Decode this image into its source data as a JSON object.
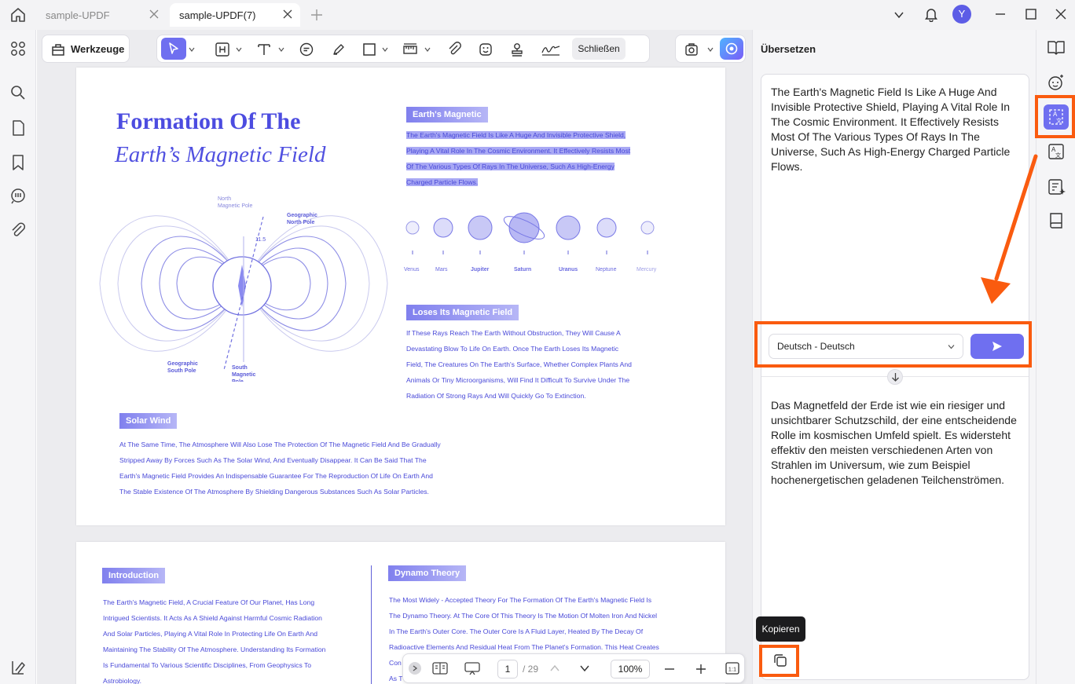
{
  "tabs": [
    {
      "label": "sample-UPDF",
      "active": false
    },
    {
      "label": "sample-UPDF(7)",
      "active": true
    }
  ],
  "window": {
    "avatar_letter": "Y"
  },
  "toolbar": {
    "tools_label": "Werkzeuge",
    "close_label": "Schließen"
  },
  "page1": {
    "title_line1": "Formation Of The",
    "title_line2": "Earth’s Magnetic Field",
    "diagram_labels": {
      "north_magnetic": "North\nMagnetic Pole",
      "geo_north": "Geographic\nNorth Pole",
      "angle": "11.5°",
      "geo_south": "Geographic\nSouth Pole",
      "south_magnetic": "South\nMagnetic\nPole"
    },
    "section1_title": "Earth's Magnetic",
    "section1_lines": [
      "The Earth's Magnetic Field Is Like A Huge And Invisible Protective Shield,",
      "Playing A Vital Role In The Cosmic Environment. It Effectively Resists Most",
      "Of The Various Types Of Rays In The Universe, Such As High-Energy",
      "Charged Particle Flows."
    ],
    "planets": [
      "Venus",
      "Mars",
      "Jupiter",
      "Saturn",
      "Uranus",
      "Neptune",
      "Mercury"
    ],
    "section2_title": "Loses Its Magnetic Field",
    "section2_lines": [
      "If These Rays Reach The Earth Without Obstruction, They Will Cause A",
      "Devastating Blow To Life On Earth. Once The Earth Loses Its Magnetic",
      "Field, The Creatures On The Earth's Surface, Whether Complex Plants And",
      "Animals Or Tiny Microorganisms, Will Find It Difficult To Survive Under The",
      "Radiation Of Strong Rays And Will Quickly Go To Extinction."
    ],
    "section3_title": "Solar Wind",
    "section3_lines": [
      "At The Same Time, The Atmosphere Will Also Lose The Protection Of The Magnetic Field And Be Gradually",
      "Stripped Away By Forces Such As The Solar Wind, And Eventually Disappear. It Can Be Said That The",
      "Earth's Magnetic Field Provides An Indispensable Guarantee For The Reproduction Of Life On Earth And",
      "The Stable Existence Of The Atmosphere By Shielding Dangerous Substances Such As Solar Particles."
    ]
  },
  "page2": {
    "intro_title": "Introduction",
    "intro_lines": [
      "The Earth's Magnetic Field, A Crucial Feature Of Our Planet, Has Long",
      "Intrigued Scientists. It Acts As A Shield Against Harmful Cosmic Radiation",
      "And Solar Particles, Playing A Vital Role In Protecting Life On Earth And",
      "Maintaining The Stability Of The Atmosphere. Understanding Its Formation",
      "Is Fundamental To Various Scientific Disciplines, From Geophysics To",
      "Astrobiology."
    ],
    "dynamo_title": "Dynamo Theory",
    "dynamo_lines": [
      "The Most Widely - Accepted Theory For The Formation Of The Earth's Magnetic Field Is",
      "The Dynamo Theory. At The Core Of This Theory Is The Motion Of Molten Iron And Nickel",
      "In The Earth's Outer Core. The Outer Core Is A Fluid Layer, Heated By The Decay Of",
      "Radioactive Elements And Residual Heat From The Planet's Formation. This Heat Creates",
      "Con",
      "As T"
    ]
  },
  "bottombar": {
    "page_current": "1",
    "page_total": "/ 29",
    "zoom": "100%"
  },
  "panel": {
    "title": "Übersetzen",
    "source_text": "The Earth's Magnetic Field Is Like A Huge And Invisible Protective Shield, Playing A Vital Role In The Cosmic Environment. It Effectively Resists Most Of The Various Types Of Rays In The Universe, Such As High-Energy Charged Particle Flows.",
    "language_select": "Deutsch - Deutsch",
    "translated_text": "Das Magnetfeld der Erde ist wie ein riesiger und unsichtbarer Schutzschild, der eine entscheidende Rolle im kosmischen Umfeld spielt. Es widersteht effektiv den meisten verschiedenen Arten von Strahlen im Universum, wie zum Beispiel hochenergetischen geladenen Teilchenströmen.",
    "copy_tooltip": "Kopieren"
  },
  "colors": {
    "accent": "#6f6ff0",
    "highlight_orange": "#fa5b0f",
    "doc_text": "#4848d8"
  }
}
